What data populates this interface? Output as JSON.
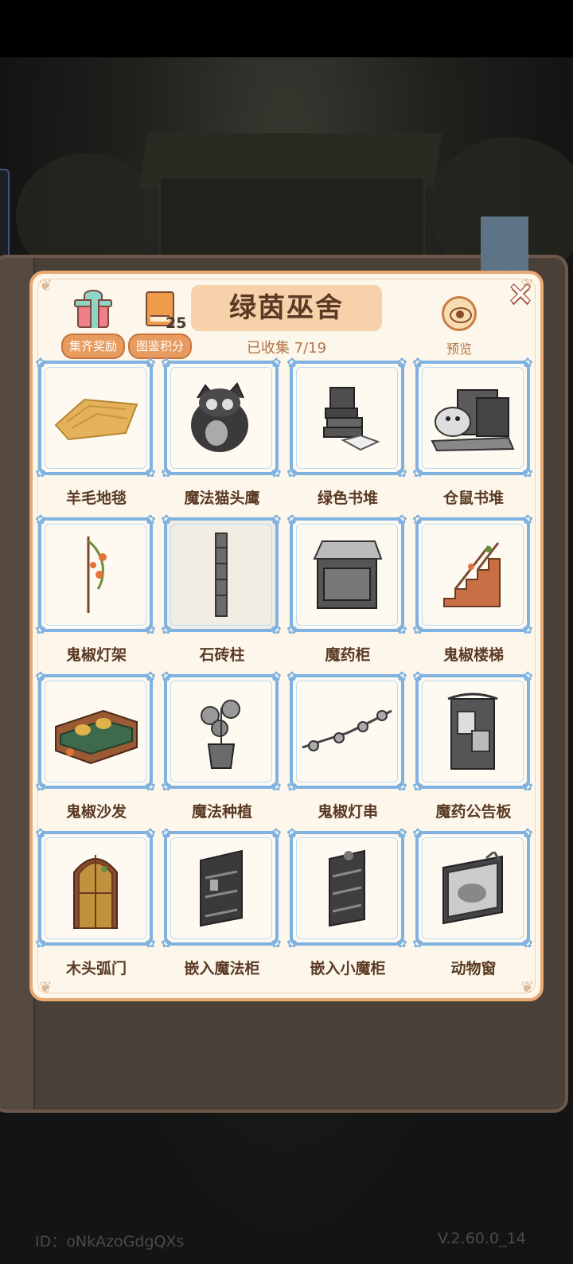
{
  "header": {
    "title": "绿茵巫舍",
    "collected": "已收集 7/19",
    "set_reward_label": "集齐奖励",
    "catalog_points_label": "图鉴积分",
    "catalog_points_value": "25",
    "preview_label": "预览"
  },
  "items": [
    {
      "label": "羊毛地毯",
      "collected": true
    },
    {
      "label": "魔法猫头鹰",
      "collected": false
    },
    {
      "label": "绿色书堆",
      "collected": false
    },
    {
      "label": "仓鼠书堆",
      "collected": false
    },
    {
      "label": "鬼椒灯架",
      "collected": true
    },
    {
      "label": "石砖柱",
      "collected": false
    },
    {
      "label": "魔药柜",
      "collected": false
    },
    {
      "label": "鬼椒楼梯",
      "collected": true
    },
    {
      "label": "鬼椒沙发",
      "collected": true
    },
    {
      "label": "魔法种植",
      "collected": false
    },
    {
      "label": "鬼椒灯串",
      "collected": false
    },
    {
      "label": "魔药公告板",
      "collected": false
    },
    {
      "label": "木头弧门",
      "collected": true
    },
    {
      "label": "嵌入魔法柜",
      "collected": false
    },
    {
      "label": "嵌入小魔柜",
      "collected": false
    },
    {
      "label": "动物窗",
      "collected": false
    }
  ],
  "footer": {
    "id": "ID：oNkAzoGdgQXs",
    "version": "V.2.60.0_14"
  }
}
